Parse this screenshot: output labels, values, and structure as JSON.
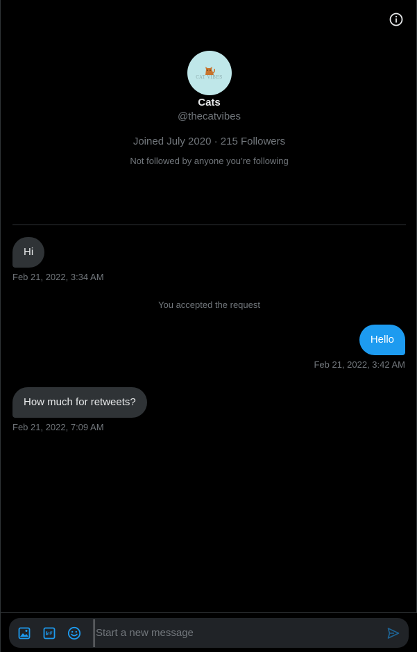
{
  "profile": {
    "name": "Cats",
    "handle": "@thecatvibes",
    "joined": "Joined July 2020",
    "separator": "·",
    "followers": "215 Followers",
    "note": "Not followed by anyone you’re following",
    "avatar_text": "CAT VIBES",
    "avatar_bg": "#bfe7e9"
  },
  "messages": [
    {
      "direction": "in",
      "text": "Hi",
      "time": "Feb 21, 2022, 3:34 AM"
    },
    {
      "direction": "out",
      "text": "Hello",
      "time": "Feb 21, 2022, 3:42 AM"
    },
    {
      "direction": "in",
      "text": "How much for retweets?",
      "time": "Feb 21, 2022, 7:09 AM"
    }
  ],
  "system_note": "You accepted the request",
  "composer": {
    "placeholder": "Start a new message",
    "icons": [
      "image-icon",
      "gif-icon",
      "emoji-icon",
      "send-icon"
    ]
  },
  "colors": {
    "accent": "#1d9bf0",
    "incoming_bubble": "#2f3336",
    "muted_text": "#71767b",
    "background": "#000000"
  }
}
